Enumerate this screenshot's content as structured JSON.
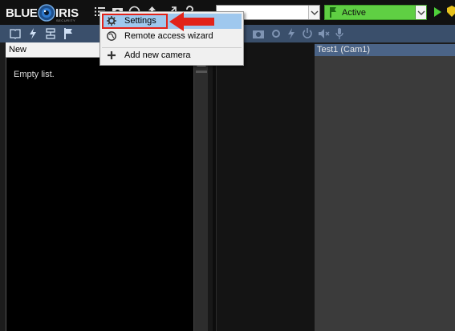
{
  "app": {
    "logo_word_left": "BLUE",
    "logo_word_right": "IRIS",
    "logo_subtitle": "SECURITY"
  },
  "toolbar": {
    "profile_value": "",
    "status_value": "Active",
    "icons": [
      "list-icon",
      "camera-icon",
      "clock-icon",
      "upload-icon",
      "resize-icon",
      "help-icon"
    ]
  },
  "left_pane": {
    "tab_label": "New",
    "empty_text": "Empty list."
  },
  "camera": {
    "header_label": "Test1  (Cam1)"
  },
  "menu": {
    "items": [
      {
        "label": "Settings",
        "icon": "gear-icon"
      },
      {
        "label": "Remote access wizard",
        "icon": "globe-icon"
      },
      {
        "label": "Add new camera",
        "icon": "plus-icon"
      }
    ]
  },
  "colors": {
    "accent_bar": "#3a4f6b",
    "status_green": "#5fcf43",
    "menu_highlight": "#9fc8ee",
    "annotation_red": "#e2231a"
  }
}
